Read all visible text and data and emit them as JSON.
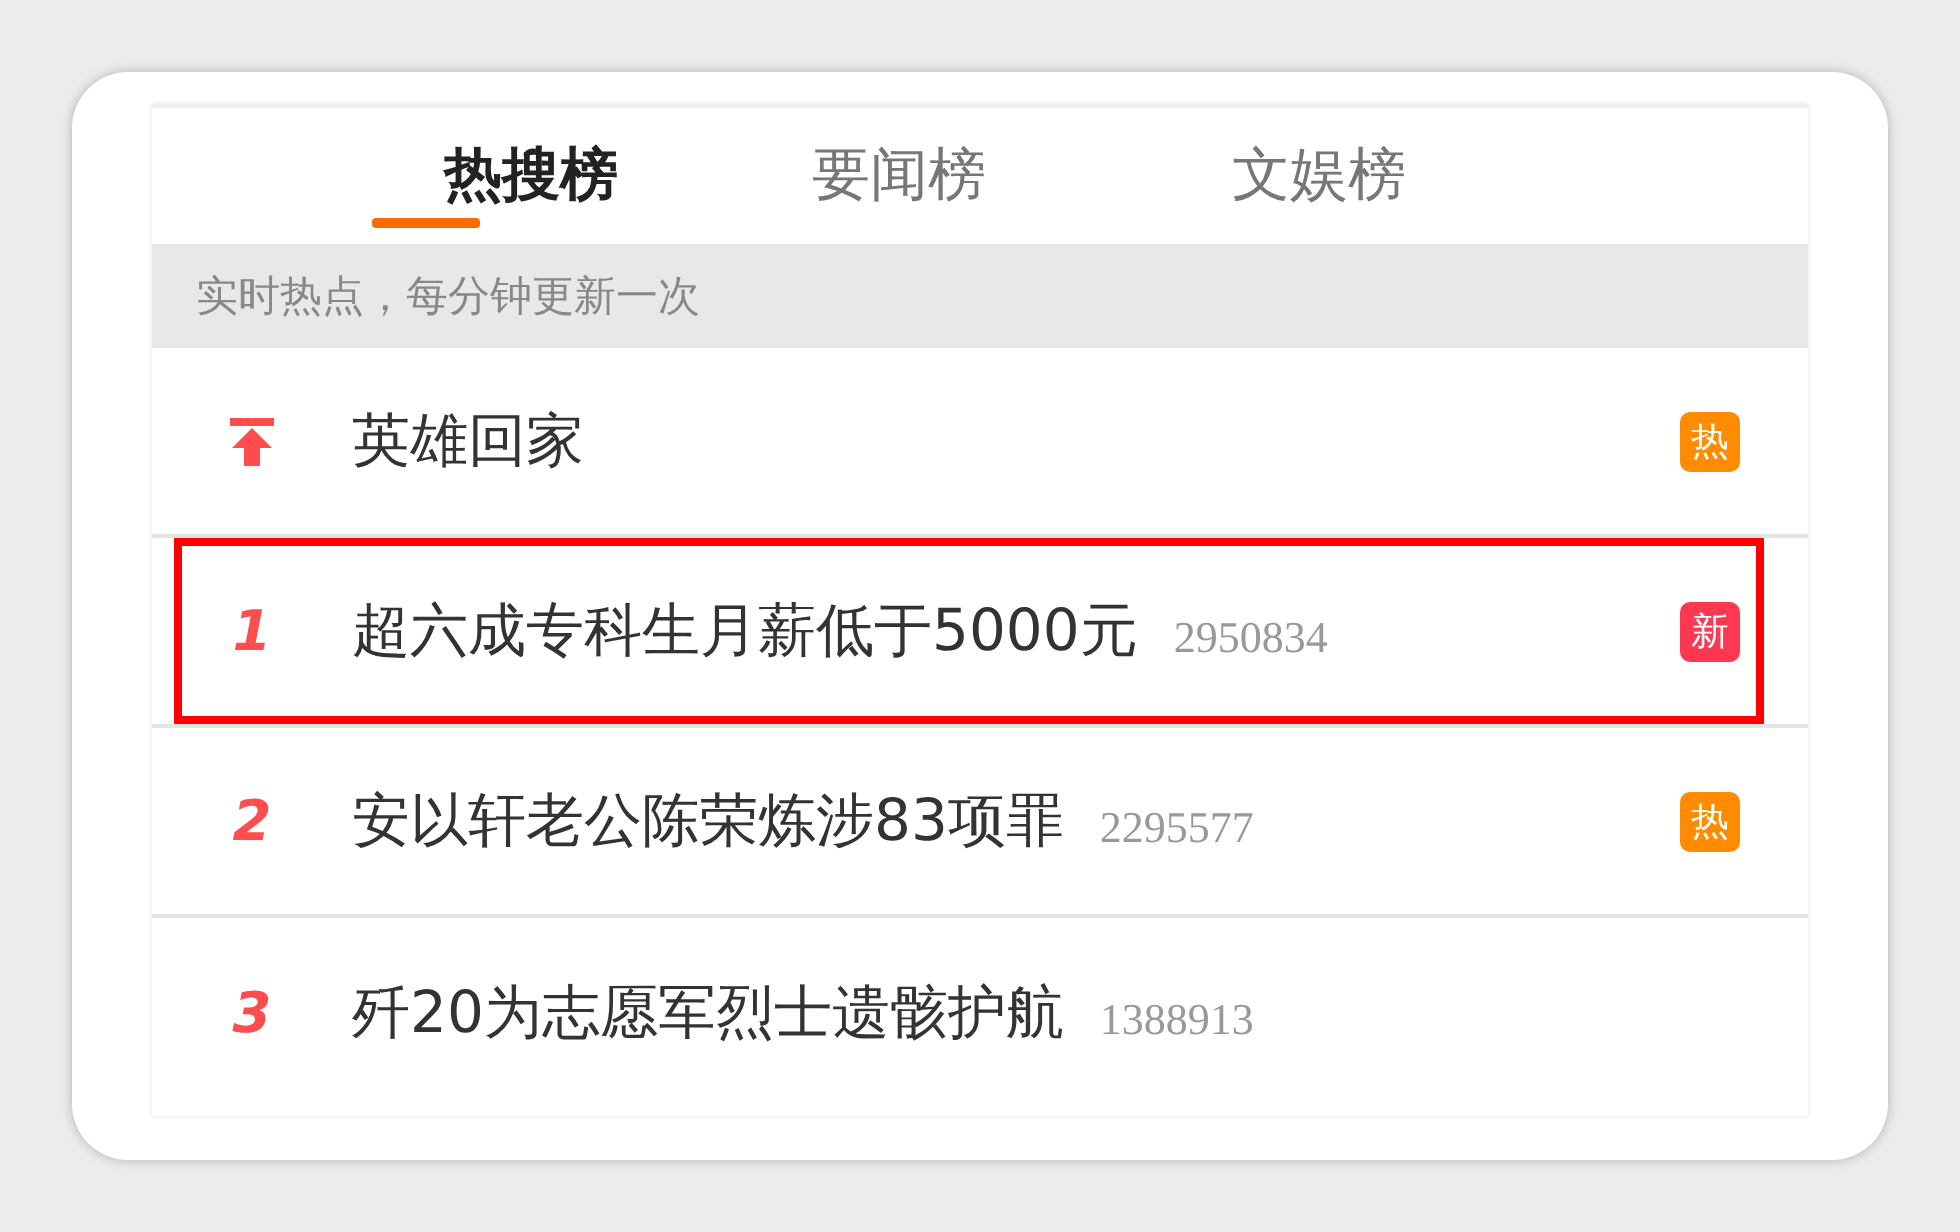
{
  "tabs": [
    {
      "label": "热搜榜",
      "selected": true
    },
    {
      "label": "要闻榜",
      "selected": false
    },
    {
      "label": "文娱榜",
      "selected": false
    }
  ],
  "subtitle": "实时热点，每分钟更新一次",
  "items": [
    {
      "kind": "pinned",
      "title": "英雄回家",
      "highlighted": false,
      "badge": {
        "label": "热",
        "color": "#ff8c00"
      }
    },
    {
      "kind": "number",
      "rank": "1",
      "title": "超六成专科生月薪低于5000元",
      "count": "2950834",
      "highlighted": true,
      "badge": {
        "label": "新",
        "color": "#ff3852"
      }
    },
    {
      "kind": "number",
      "rank": "2",
      "title": "安以轩老公陈荣炼涉83项罪",
      "count": "2295577",
      "highlighted": false,
      "badge": {
        "label": "热",
        "color": "#ff8c00"
      }
    },
    {
      "kind": "number",
      "rank": "3",
      "title": "歼20为志愿军烈士遗骸护航",
      "count": "1388913",
      "highlighted": false
    }
  ]
}
